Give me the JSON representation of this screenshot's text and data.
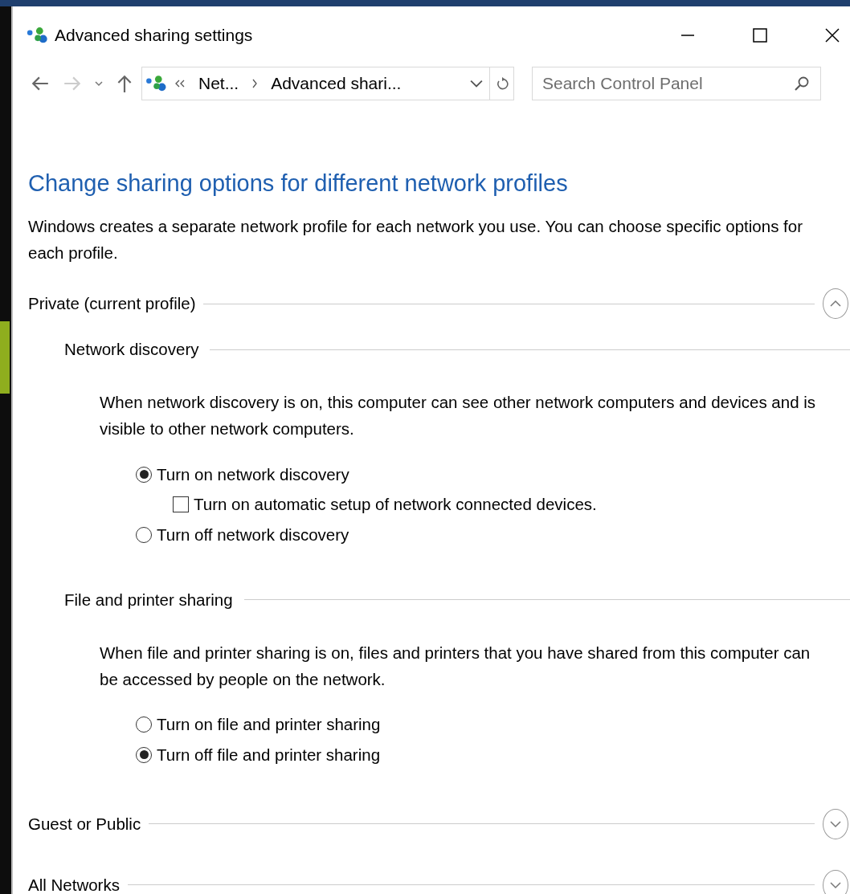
{
  "window": {
    "title": "Advanced sharing settings"
  },
  "address_bar": {
    "crumbs": [
      "Net...",
      "Advanced shari..."
    ]
  },
  "search": {
    "placeholder": "Search Control Panel"
  },
  "heading": "Change sharing options for different network profiles",
  "intro": "Windows creates a separate network profile for each network you use. You can choose specific options for each profile.",
  "sections": [
    {
      "title": "Private (current profile)",
      "expanded": true,
      "groups": [
        {
          "title": "Network discovery",
          "description": "When network discovery is on, this computer can see other network computers and devices and is visible to other network computers.",
          "options": [
            {
              "kind": "radio",
              "label": "Turn on network discovery",
              "selected": true,
              "children": [
                {
                  "kind": "checkbox",
                  "label": "Turn on automatic setup of network connected devices.",
                  "checked": false
                }
              ]
            },
            {
              "kind": "radio",
              "label": "Turn off network discovery",
              "selected": false
            }
          ]
        },
        {
          "title": "File and printer sharing",
          "description": "When file and printer sharing is on, files and printers that you have shared from this computer can be accessed by people on the network.",
          "options": [
            {
              "kind": "radio",
              "label": "Turn on file and printer sharing",
              "selected": false
            },
            {
              "kind": "radio",
              "label": "Turn off file and printer sharing",
              "selected": true
            }
          ]
        }
      ]
    },
    {
      "title": "Guest or Public",
      "expanded": false
    },
    {
      "title": "All Networks",
      "expanded": false
    }
  ]
}
